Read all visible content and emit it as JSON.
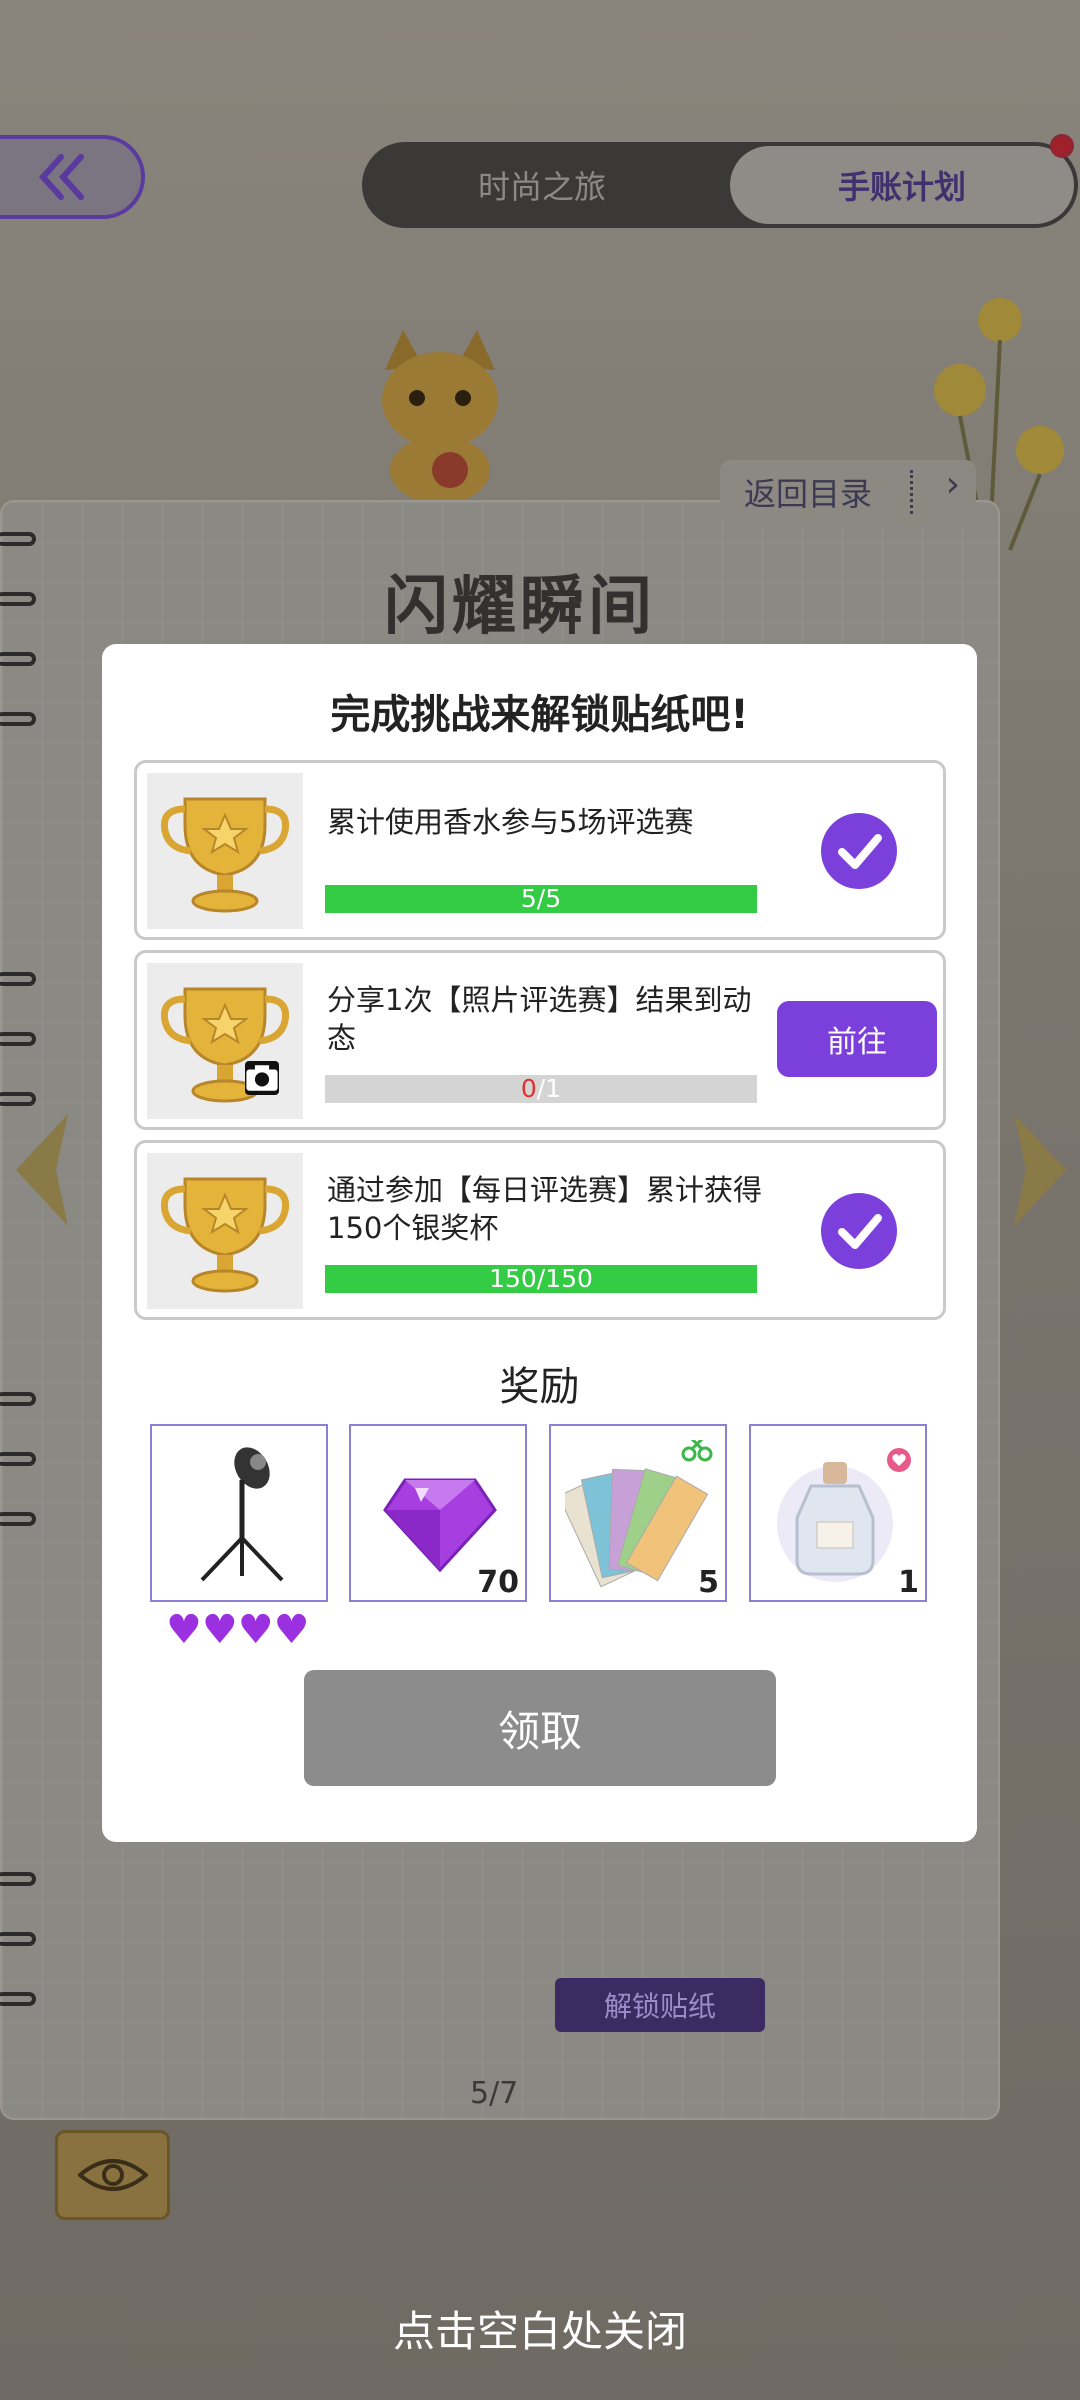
{
  "header": {
    "back_icon": "double-chevron-left-icon",
    "tabs": [
      {
        "label": "时尚之旅",
        "active": false
      },
      {
        "label": "手账计划",
        "active": true
      }
    ]
  },
  "journal": {
    "catalog_label": "返回目录",
    "chapter_title": "闪耀瞬间",
    "page_number": "5/7",
    "unlock_sticker_label": "解锁贴纸"
  },
  "dialog": {
    "title": "完成挑战来解锁贴纸吧!",
    "tasks": [
      {
        "text": "累计使用香水参与5场评选赛",
        "current": "5",
        "total": "5",
        "progress": 1.0,
        "status": "completed"
      },
      {
        "text": "分享1次【照片评选赛】结果到动态",
        "current": "0",
        "total": "1",
        "progress": 0.0,
        "status": "go",
        "action_label": "前往"
      },
      {
        "text": "通过参加【每日评选赛】累计获得150个银奖杯",
        "current": "150",
        "total": "150",
        "progress": 1.0,
        "status": "completed"
      }
    ],
    "rewards_title": "奖励",
    "rewards": [
      {
        "icon": "spotlight-stand-icon",
        "count": "",
        "hearts": 4
      },
      {
        "icon": "purple-diamond-icon",
        "count": "70"
      },
      {
        "icon": "color-swatch-icon",
        "count": "5"
      },
      {
        "icon": "perfume-bottle-icon",
        "count": "1"
      }
    ],
    "claim_label": "领取"
  },
  "close_hint": "点击空白处关闭",
  "colors": {
    "accent_purple": "#7b3fdc",
    "progress_green": "#33cc44",
    "claim_disabled": "#8c8c8c"
  }
}
